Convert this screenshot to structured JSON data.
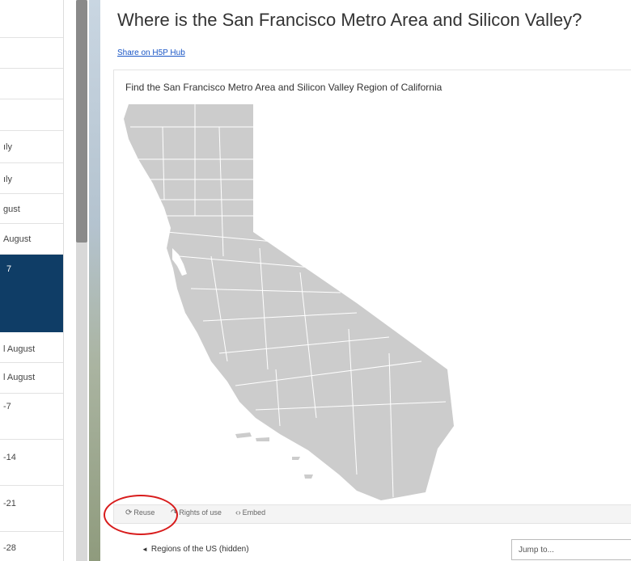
{
  "sidebar": {
    "items": [
      {
        "label": ""
      },
      {
        "label": ""
      },
      {
        "label": ""
      },
      {
        "label": ""
      },
      {
        "label": "ıly"
      },
      {
        "label": "ıly"
      },
      {
        "label": "gust"
      },
      {
        "label": "August"
      },
      {
        "label": "7"
      },
      {
        "label": "l August"
      },
      {
        "label": "l August"
      },
      {
        "label": "-7"
      },
      {
        "label": "-14"
      },
      {
        "label": "-21"
      },
      {
        "label": "-28"
      }
    ]
  },
  "page": {
    "title": "Where is the San Francisco Metro Area and Silicon Valley?",
    "share_link": "Share on H5P Hub"
  },
  "h5p": {
    "task_title": "Find the San Francisco Metro Area and Silicon Valley Region of California",
    "map_fill": "#cccccc",
    "map_border": "#ffffff",
    "footer": {
      "reuse": "Reuse",
      "rights": "Rights of use",
      "embed": "Embed"
    }
  },
  "annotation": {
    "color": "#d81c1c"
  },
  "nav": {
    "prev": "Regions of the US (hidden)",
    "jump_placeholder": "Jump to..."
  },
  "colors": {
    "sidebar_active": "#0f3d66",
    "link": "#1a56c6"
  }
}
